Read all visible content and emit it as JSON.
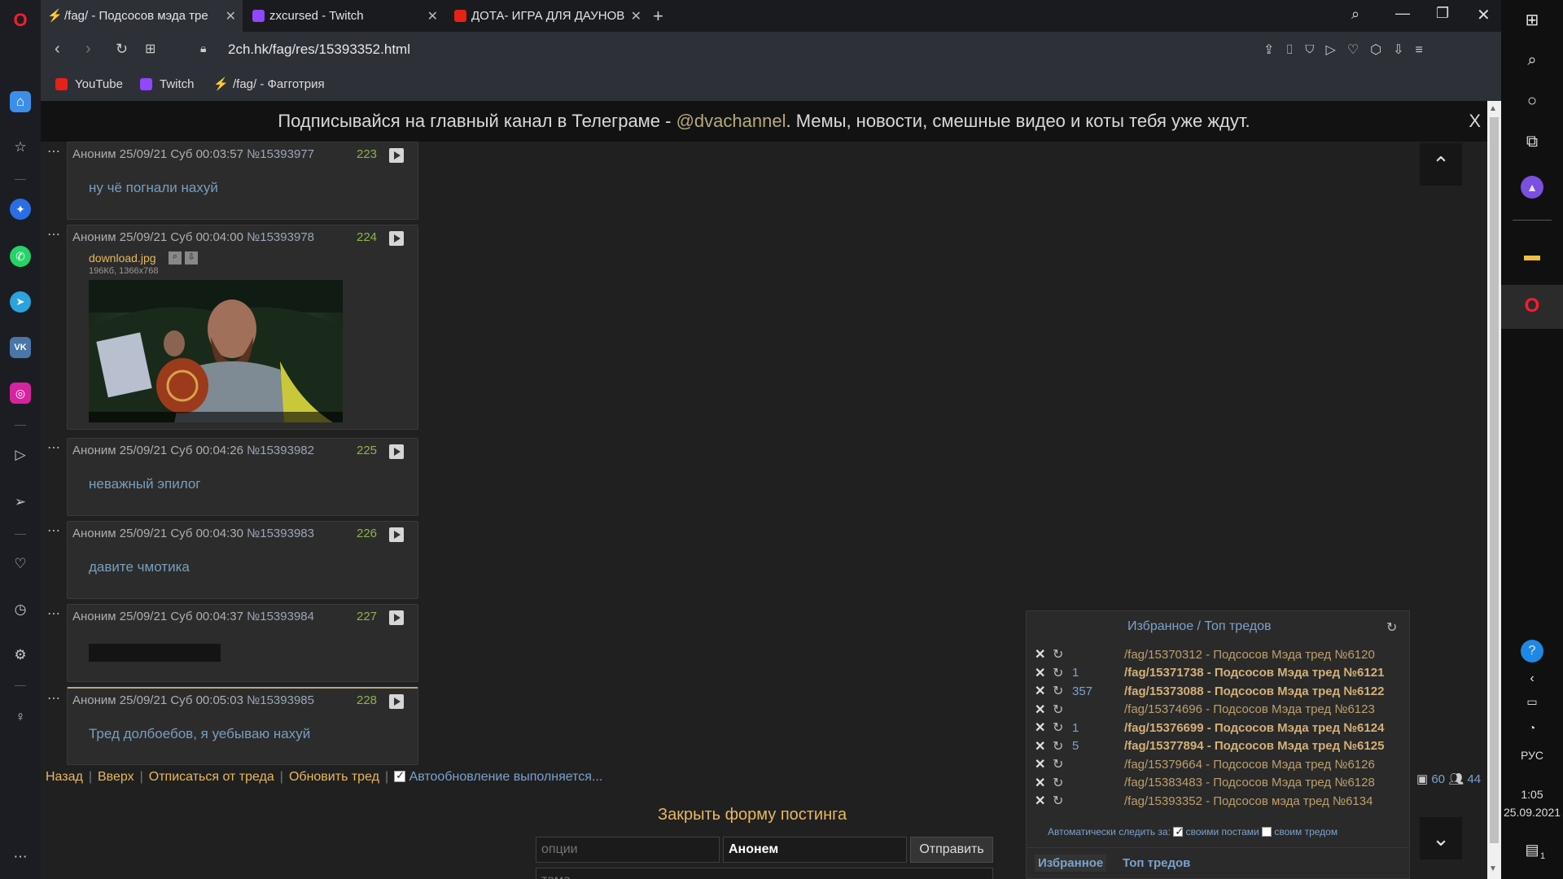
{
  "tabs": [
    {
      "title": "/fag/ - Подсосов мэда тре",
      "icon": "lightning-icon"
    },
    {
      "title": "zxcursed - Twitch",
      "icon": "twitch-icon"
    },
    {
      "title": "ДОТА- ИГРА ДЛЯ ДАУНОВ",
      "icon": "youtube-icon"
    }
  ],
  "address": {
    "url": "2ch.hk/fag/res/15393352.html"
  },
  "bookmarks": [
    {
      "label": "YouTube",
      "icon": "youtube-icon"
    },
    {
      "label": "Twitch",
      "icon": "twitch-icon"
    },
    {
      "label": "/fag/ - Фагготрия",
      "icon": "lightning-icon"
    }
  ],
  "banner": {
    "prefix": "Подписывайся на главный канал в Телеграме - ",
    "link": "@dvachannel",
    "suffix": ". Мемы, новости, смешные видео и коты тебя уже ждут.",
    "close": "X"
  },
  "posts": [
    {
      "header": "Аноним 25/09/21 Суб 00:03:57",
      "num": "№15393977",
      "count": "223",
      "text": "ну чё погнали нахуй"
    },
    {
      "header": "Аноним 25/09/21 Суб 00:04:00",
      "num": "№15393978",
      "count": "224",
      "text": "",
      "file": {
        "name": "download.jpg",
        "meta": "196Кб, 1366x768"
      }
    },
    {
      "header": "Аноним 25/09/21 Суб 00:04:26",
      "num": "№15393982",
      "count": "225",
      "text": "неважный эпилог"
    },
    {
      "header": "Аноним 25/09/21 Суб 00:04:30",
      "num": "№15393983",
      "count": "226",
      "text": "давите чмотика"
    },
    {
      "header": "Аноним 25/09/21 Суб 00:04:37",
      "num": "№15393984",
      "count": "227",
      "text": ""
    },
    {
      "header": "Аноним 25/09/21 Суб 00:05:03",
      "num": "№15393985",
      "count": "228",
      "text": "Тред долбоебов, я уебываю нахуй"
    }
  ],
  "footer_nav": {
    "back": "Назад",
    "up": "Вверх",
    "unsubscribe": "Отписаться от треда",
    "refresh": "Обновить тред",
    "autoupdate": "Автообновление выполняется..."
  },
  "stats": {
    "images": "60",
    "posters": "44"
  },
  "favorites": {
    "title_fav": "Избранное",
    "sep": " / ",
    "title_top": "Топ тредов",
    "rows": [
      {
        "count": "",
        "title": "/fag/15370312 - Подсосов Мэда тред №6120",
        "bold": false
      },
      {
        "count": "1",
        "title": "/fag/15371738 - Подсосов Мэда тред №6121",
        "bold": true
      },
      {
        "count": "357",
        "title": "/fag/15373088 - Подсосов Мэда тред №6122",
        "bold": true
      },
      {
        "count": "",
        "title": "/fag/15374696 - Подсосов Мэда тред №6123",
        "bold": false
      },
      {
        "count": "1",
        "title": "/fag/15376699 - Подсосов Мэда тред №6124",
        "bold": true
      },
      {
        "count": "5",
        "title": "/fag/15377894 - Подсосов Мэда тред №6125",
        "bold": true
      },
      {
        "count": "",
        "title": "/fag/15379664 - Подсосов Мэда тред №6126",
        "bold": false
      },
      {
        "count": "",
        "title": "/fag/15383483 - Подсосов Мэда тред №6128",
        "bold": false
      },
      {
        "count": "",
        "title": "/fag/15393352 - Подсосов мэда тред №6134",
        "bold": false
      }
    ],
    "auto_label": "Автоматически следить за:",
    "opt1": "своими постами",
    "opt2": "своим тредом",
    "tab_fav": "Избранное",
    "tab_top": "Топ тредов"
  },
  "post_form": {
    "close": "Закрыть форму постинга",
    "options_placeholder": "опции",
    "name_value": "Анонем",
    "submit": "Отправить",
    "subject_placeholder": "тема"
  },
  "taskbar": {
    "lang": "РУС",
    "time": "1:05",
    "date": "25.09.2021",
    "notif": "1"
  }
}
